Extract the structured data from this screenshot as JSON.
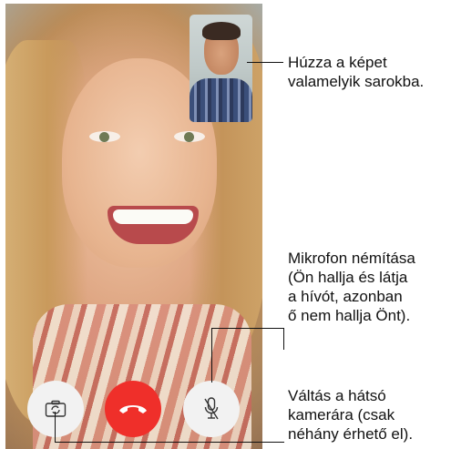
{
  "callouts": {
    "drag": [
      "Húzza a képet",
      "valamelyik sarokba."
    ],
    "mute": [
      "Mikrofon némítása",
      "(Ön hallja és látja",
      "a hívót, azonban",
      "ő nem hallja Önt)."
    ],
    "switch": [
      "Váltás a hátsó",
      "kamerára (csak",
      "néhány érhető el)."
    ]
  },
  "controls": {
    "flip_icon": "camera-flip-icon",
    "end_icon": "end-call-icon",
    "mute_icon": "microphone-muted-icon",
    "end_color": "#ef2f2a"
  }
}
